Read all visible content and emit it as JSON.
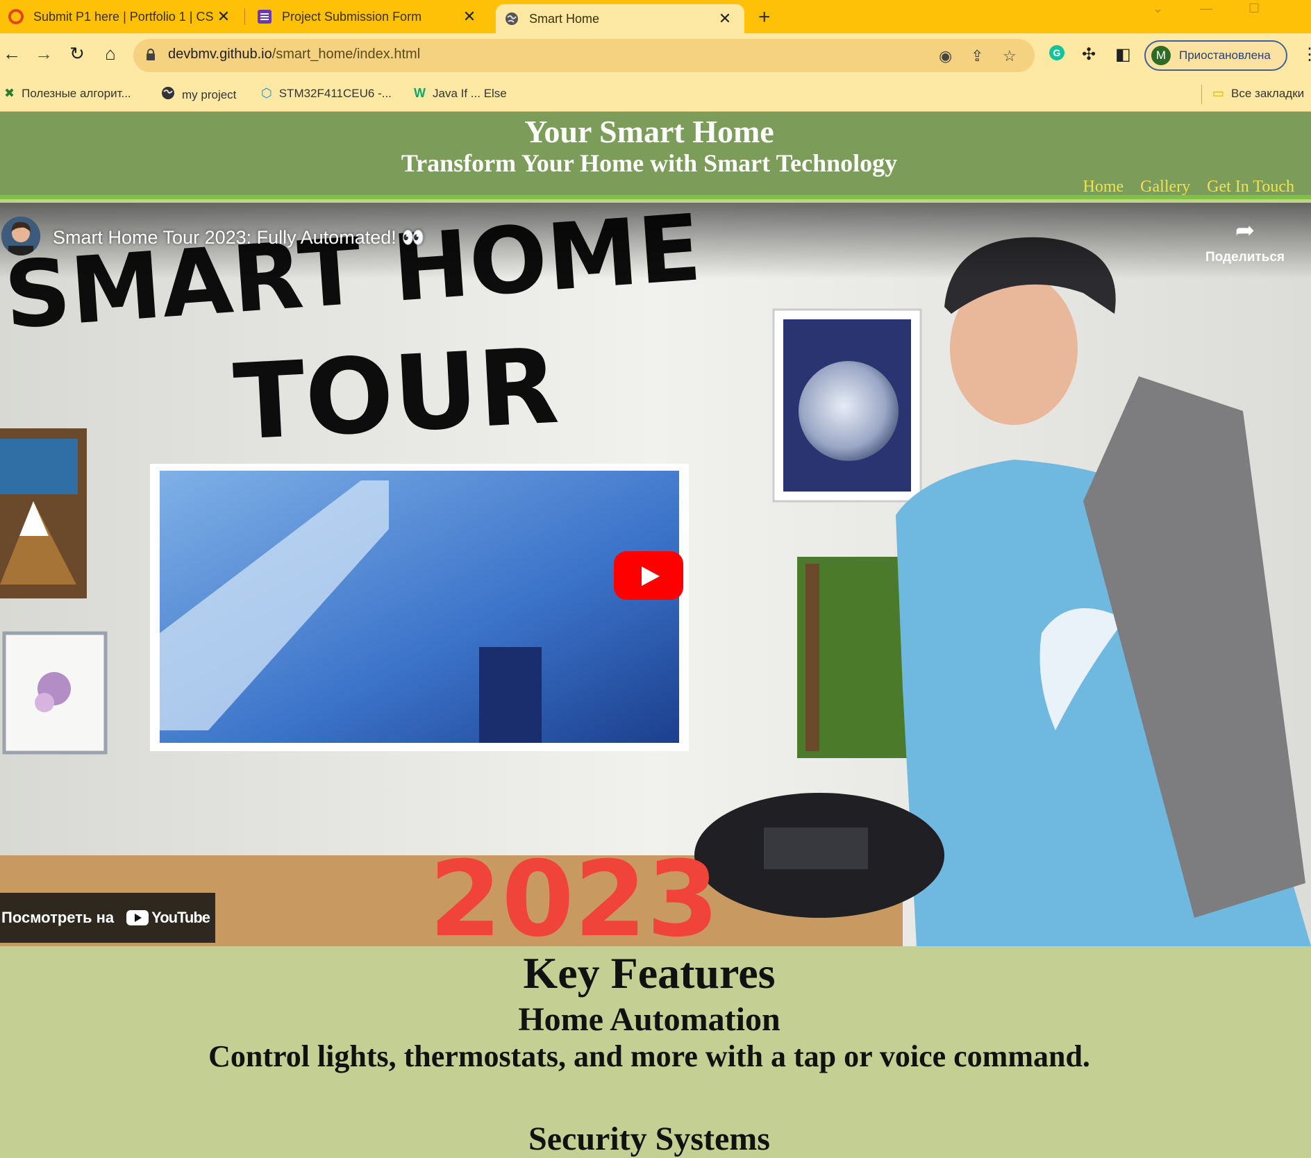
{
  "browser": {
    "tabs": [
      {
        "title": "Submit P1 here | Portfolio 1 | CS",
        "icon": "canvas-icon"
      },
      {
        "title": "Project Submission Form",
        "icon": "forms-icon"
      },
      {
        "title": "Smart Home",
        "icon": "globe-icon"
      }
    ],
    "close_glyph": "✕",
    "new_tab_glyph": "+",
    "url_host": "devbmv.github.io",
    "url_path": "/smart_home/index.html",
    "profile_initial": "M",
    "profile_status": "Приостановлена",
    "bookmarks": [
      {
        "label": "Полезные алгорит...",
        "icon": "tool-icon"
      },
      {
        "label": "my project",
        "icon": "globe-icon"
      },
      {
        "label": "STM32F411CEU6 -...",
        "icon": "hexagon-icon"
      },
      {
        "label": "Java If ... Else",
        "icon": "w3schools-icon"
      }
    ],
    "all_bookmarks": "Все закладки"
  },
  "site": {
    "title": "Your Smart Home",
    "subtitle": "Transform Your Home with Smart Technology",
    "nav": [
      "Home",
      "Gallery",
      "Get In Touch"
    ]
  },
  "video": {
    "title": "Smart Home Tour 2023: Fully Automated! 👀",
    "share_label": "Поделиться",
    "watch_on": "Посмотреть на",
    "youtube": "YouTube",
    "thumb_line1": "SMART HOME",
    "thumb_line2": "TOUR",
    "thumb_year": "2023",
    "colors": {
      "play": "#ff0000",
      "year": "#f0443a",
      "shirt": "#6fb8e0"
    }
  },
  "features": {
    "heading": "Key Features",
    "items": [
      {
        "title": "Home Automation",
        "text": "Control lights, thermostats, and more with a tap or voice command."
      },
      {
        "title": "Security Systems"
      }
    ]
  }
}
